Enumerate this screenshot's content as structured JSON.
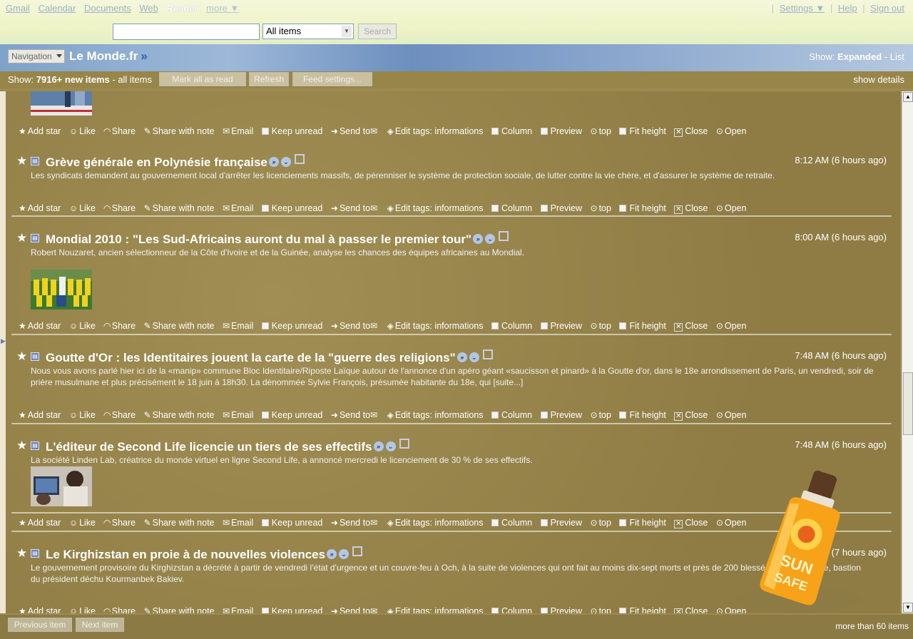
{
  "gbar": {
    "links": [
      "Gmail",
      "Calendar",
      "Documents",
      "Web"
    ],
    "current": "Reader",
    "more": "more ▼"
  },
  "guser": {
    "sep1": "|",
    "settings": "Settings ▼",
    "sep2": "|",
    "help": "Help",
    "sep3": "|",
    "signout": "Sign out"
  },
  "search": {
    "scope": "All items",
    "button": "Search"
  },
  "header": {
    "nav": "Navigation",
    "title": "Le Monde.fr",
    "title_more": "»",
    "show_label": "Show:",
    "expanded": "Expanded",
    "dash": "-",
    "list": "List"
  },
  "controls": {
    "show": "Show:",
    "count": "7916+ new items",
    "all": "- all items",
    "mark_read": "Mark all as read",
    "refresh": "Refresh",
    "feed_settings": "Feed settings...",
    "show_details": "show details"
  },
  "actions": {
    "add_star": "Add star",
    "like": "Like",
    "share": "Share",
    "share_note": "Share with note",
    "email": "Email",
    "keep_unread": "Keep unread",
    "send_to": "Send to",
    "edit_tags": "Edit tags:",
    "tags": "informations",
    "column": "Column",
    "preview": "Preview",
    "top": "top",
    "fit_height": "Fit height",
    "close": "Close",
    "open": "Open"
  },
  "entries": [
    {
      "title": "Grève générale en Polynésie française",
      "time": "8:12 AM (6 hours ago)",
      "snippet": "Les syndicats demandent au gouvernement local d'arrêter les licenciements massifs, de pérenniser le système de protection sociale, de lutter contre la vie chère, et d'assurer le système de retraite."
    },
    {
      "title": "Mondial 2010 : \"Les Sud-Africains auront du mal à passer le premier tour\"",
      "time": "8:00 AM (6 hours ago)",
      "snippet": "Robert Nouzaret, ancien sélectionneur de la Côte d'Ivoire et de la Guinée, analyse les chances des équipes africaines au Mondial."
    },
    {
      "title": "Goutte d'Or : les Identitaires jouent la carte de la \"guerre des religions\"",
      "time": "7:48 AM (6 hours ago)",
      "snippet": "Nous vous avons parlé hier ici de la «manip» commune Bloc Identitaire/Riposte Laïque autour de l'annonce d'un apéro géant «saucisson et pinard» à la Goutte d'or, dans le 18e arrondissement de Paris, un vendredi, soir de prière musulmane et plus précisément le 18 juin à 18h30. La dénommée Sylvie François, présumée habitante du 18e, qui [suite...]"
    },
    {
      "title": "L'éditeur de Second Life licencie un tiers de ses effectifs",
      "time": "7:48 AM (6 hours ago)",
      "snippet": "La société Linden Lab, créatrice du monde virtuel en ligne Second Life, a annoncé mercredi le licenciement de 30 % de ses effectifs."
    },
    {
      "title": "Le Kirghizstan en proie à de nouvelles violences",
      "time": "7:17 AM (7 hours ago)",
      "snippet": "Le gouvernement provisoire du Kirghizstan a décrété à partir de vendredi l'état d'urgence et un couvre-feu à Och, à la suite de violences qui ont fait au moins dix-sept morts et près de 200 blessés dans cette ville, bastion du président déchu Kourmanbek Bakiev."
    }
  ],
  "bottom": {
    "prev": "Previous item",
    "next": "Next item",
    "count": "more than 60 items"
  },
  "bottle": {
    "line1": "SUN",
    "line2": "SAFE"
  }
}
